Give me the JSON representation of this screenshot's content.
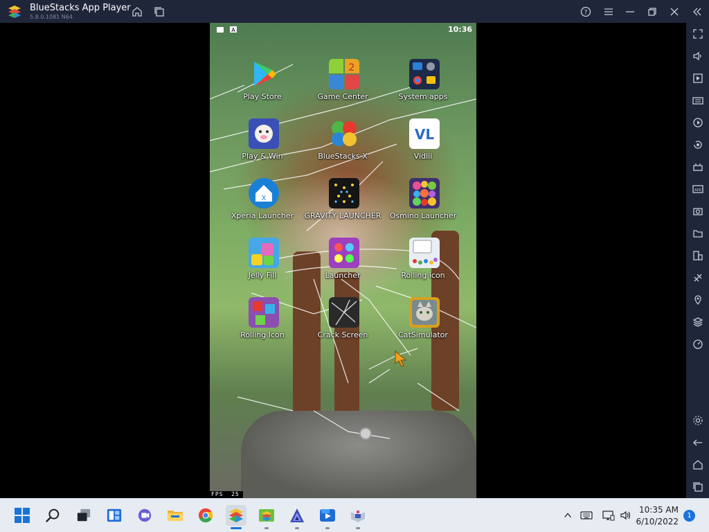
{
  "titlebar": {
    "title": "BlueStacks App Player",
    "version": "5.8.0.1081 N64",
    "icons": [
      "home-icon",
      "multi-instance-icon",
      "help-icon",
      "menu-icon",
      "minimize-icon",
      "restore-icon",
      "close-icon",
      "collapse-sidebar-icon"
    ]
  },
  "sidebar": {
    "icons": [
      "fullscreen-icon",
      "volume-icon",
      "media-manager-icon",
      "keyboard-controls-icon",
      "macro-icon",
      "rotate-icon",
      "game-controls-icon",
      "apk-install-icon",
      "screenshot-icon",
      "folder-icon",
      "multi-instance-manager-icon",
      "eco-mode-icon",
      "location-icon",
      "layers-icon",
      "performance-icon",
      "settings-icon",
      "back-icon",
      "android-home-icon",
      "recent-apps-icon"
    ]
  },
  "phone": {
    "time": "10:36",
    "fps_label": "FPS",
    "fps_value": "25",
    "apps": [
      {
        "label": "Play Store"
      },
      {
        "label": "Game Center"
      },
      {
        "label": "System apps"
      },
      {
        "label": "Play & Win"
      },
      {
        "label": "BlueStacks X"
      },
      {
        "label": "Vidlii"
      },
      {
        "label": "Xperia Launcher"
      },
      {
        "label": "GRAVITY LAUNCHER"
      },
      {
        "label": "Osmino Launcher"
      },
      {
        "label": "Jelly Fill"
      },
      {
        "label": "Launcher"
      },
      {
        "label": "Rolling icon"
      },
      {
        "label": "Rolling Icon"
      },
      {
        "label": "Crack Screen"
      },
      {
        "label": "CatSimulator"
      }
    ]
  },
  "taskbar": {
    "apps": [
      "start-icon",
      "search-icon",
      "task-view-icon",
      "widgets-icon",
      "teams-chat-icon",
      "file-explorer-icon",
      "chrome-icon",
      "bluestacks-icon",
      "bluestacks-multi-instance-icon",
      "affinity-icon",
      "media-player-icon",
      "virtual-box-icon"
    ],
    "time": "10:35 AM",
    "date": "6/10/2022",
    "notifications": "1"
  },
  "colors": {
    "titlebar_bg": "#20263a",
    "taskbar_bg": "#e7ecf2",
    "accent": "#1a73d9"
  }
}
